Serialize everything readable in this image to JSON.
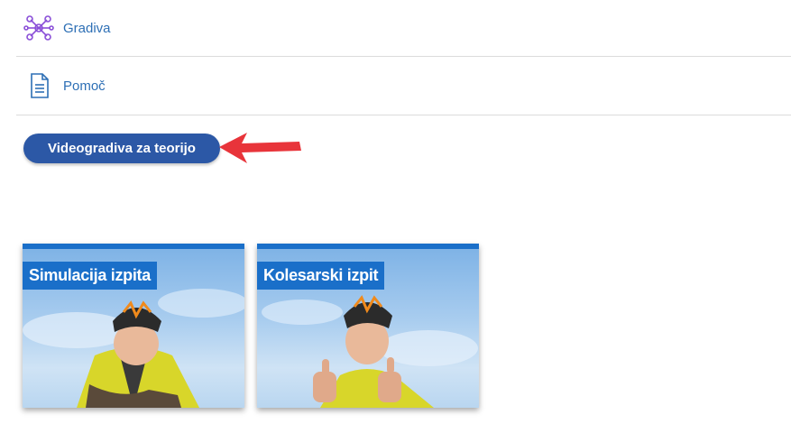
{
  "menu": {
    "items": [
      {
        "label": "Gradiva",
        "icon": "network-nodes-icon"
      },
      {
        "label": "Pomoč",
        "icon": "document-icon"
      }
    ]
  },
  "button": {
    "label": "Videogradiva za teorijo"
  },
  "colors": {
    "accent": "#2c58a6",
    "link": "#2d6fb5",
    "card_banner": "#1a6fc9",
    "arrow": "#e8343a",
    "icon_purple": "#8a4fd8"
  },
  "cards": [
    {
      "title": "Simulacija izpita"
    },
    {
      "title": "Kolesarski izpit"
    }
  ]
}
